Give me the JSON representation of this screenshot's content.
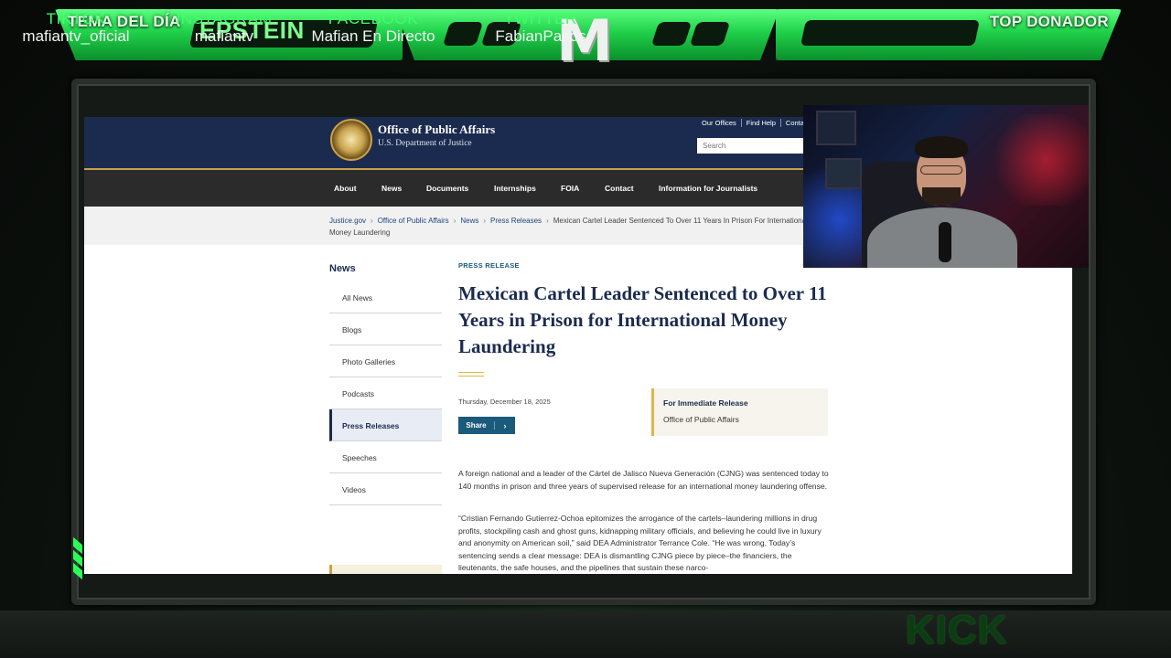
{
  "overlay": {
    "topic_title": "TEMA DEL DÍA",
    "topic_text": "EPSTEIN",
    "top_donor_title": "TOP DONADOR",
    "logo_letter": "M",
    "accent_color": "#2bff5c"
  },
  "site": {
    "org_title": "Office of Public Affairs",
    "org_subtitle": "U.S. Department of Justice",
    "utility_links": [
      "Our Offices",
      "Find Help",
      "Contact"
    ],
    "search_placeholder": "Search",
    "nav": [
      "About",
      "News",
      "Documents",
      "Internships",
      "FOIA",
      "Contact",
      "Information for Journalists"
    ],
    "breadcrumbs": [
      "Justice.gov",
      "Office of Public Affairs",
      "News",
      "Press Releases"
    ],
    "breadcrumb_current": "Mexican Cartel Leader Sentenced To Over 11 Years In Prison For International Money Laundering",
    "sidebar_heading": "News",
    "sidebar_items": [
      "All News",
      "Blogs",
      "Photo Galleries",
      "Podcasts",
      "Press Releases",
      "Speeches",
      "Videos"
    ],
    "sidebar_active": "Press Releases"
  },
  "article": {
    "label": "PRESS RELEASE",
    "headline": "Mexican Cartel Leader Sentenced to Over 11 Years in Prison for International Money Laundering",
    "date": "Thursday, December 18, 2025",
    "share_label": "Share",
    "release_title": "For Immediate Release",
    "release_office": "Office of Public Affairs",
    "paragraph_1": "A foreign national and a leader of the Cártel de Jalisco Nueva Generación (CJNG) was sentenced today to 140 months in prison and three years of supervised release for an international money laundering offense.",
    "paragraph_2": "“Cristian Fernando Gutierrez-Ochoa epitomizes the arrogance of the cartels–laundering millions in drug profits, stockpiling cash and ghost guns, kidnapping military officials, and believing he could live in luxury and anonymity on American soil,” said DEA Administrator Terrance Cole. “He was wrong. Today’s sentencing sends a clear message: DEA is dismantling CJNG piece by piece–the financiers, the lieutenants, the safe houses, and the pipelines that sustain these narco-"
  },
  "socials": [
    {
      "label": "TIKTOK",
      "handle": "mafiantv_oficial"
    },
    {
      "label": "INSTAGRAM",
      "handle": "mafiantv"
    },
    {
      "label": "FACEBOOK",
      "handle": "Mafian En Directo"
    },
    {
      "label": "TWITTER",
      "handle": "FabianPasos"
    }
  ],
  "kick_text": "KICK"
}
